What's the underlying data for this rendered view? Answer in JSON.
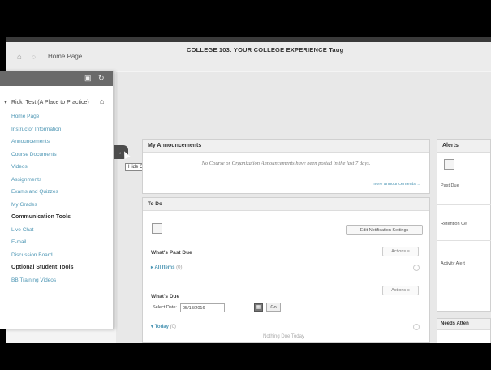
{
  "breadcrumb": {
    "home_icon": "home-icon",
    "current": "Home Page"
  },
  "header": {
    "course_title": "COLLEGE 103: YOUR COLLEGE EXPERIENCE  Taug"
  },
  "sidebar": {
    "course_name": "Rick_Test (A Place to Practice)",
    "items": [
      {
        "label": "Home Page",
        "bold": false
      },
      {
        "label": "Instructor Information",
        "bold": false
      },
      {
        "label": "Announcements",
        "bold": false
      },
      {
        "label": "Course Documents",
        "bold": false
      },
      {
        "label": "Videos",
        "bold": false
      },
      {
        "label": "Assignments",
        "bold": false
      },
      {
        "label": "Exams and Quizzes",
        "bold": false
      },
      {
        "label": "My Grades",
        "bold": false
      },
      {
        "label": "Communication Tools",
        "bold": true
      },
      {
        "label": "Live Chat",
        "bold": false
      },
      {
        "label": "E-mail",
        "bold": false
      },
      {
        "label": "Discussion Board",
        "bold": false
      },
      {
        "label": "Optional Student Tools",
        "bold": true
      },
      {
        "label": "BB Training Videos",
        "bold": false
      }
    ],
    "hide_tooltip": "Hide Course Menu"
  },
  "announcements": {
    "title": "My Announcements",
    "message": "No Course or Organization Announcements have been posted in the last 7 days.",
    "more_link": "more announcements →"
  },
  "todo": {
    "title": "To Do",
    "edit_button": "Edit Notification Settings",
    "past_due_label": "What's Past Due",
    "past_due_actions": "Actions ≡",
    "all_items": "All Items",
    "all_items_count": "(0)",
    "due_label": "What's Due",
    "due_actions": "Actions ≡",
    "select_date_label": "Select Date:",
    "date_value": "05/18/2016",
    "go_button": "Go",
    "today": "Today",
    "today_count": "(0)",
    "nothing_due": "Nothing Due Today"
  },
  "alerts": {
    "title": "Alerts",
    "past_due": "Past Due",
    "retention": "Retention Ce",
    "activity": "Activity Alert"
  },
  "needs": {
    "title": "Needs Atten"
  }
}
